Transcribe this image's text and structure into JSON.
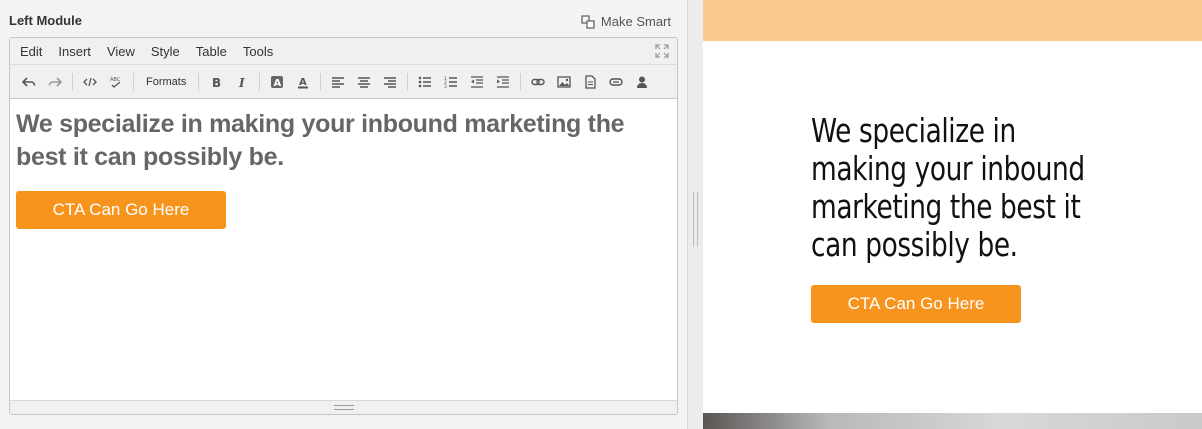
{
  "module": {
    "title": "Left Module",
    "make_smart_label": "Make Smart"
  },
  "menubar": {
    "items": [
      "Edit",
      "Insert",
      "View",
      "Style",
      "Table",
      "Tools"
    ]
  },
  "toolbar": {
    "formats_label": "Formats"
  },
  "editor": {
    "heading": "We specialize in making your inbound marketing the best it can possibly be.",
    "cta_label": "CTA Can Go Here"
  },
  "preview": {
    "heading": "We specialize in making your inbound marketing the best it can possibly be.",
    "cta_label": "CTA Can Go Here"
  },
  "colors": {
    "cta": "#f7941d",
    "preview_topbar": "#f9c98d",
    "editor_heading": "#666666"
  }
}
